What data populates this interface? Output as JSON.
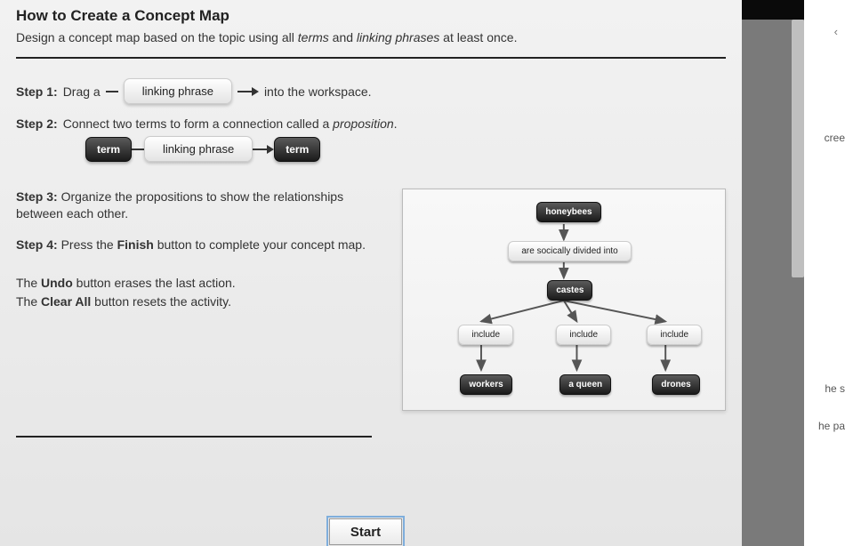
{
  "title": "How to Create a Concept Map",
  "intro_pre": "Design a concept map based on the topic using all ",
  "intro_terms": "terms",
  "intro_and": " and ",
  "intro_linking": "linking phrases",
  "intro_post": " at least once.",
  "step1": {
    "label": "Step 1:",
    "pre": "Drag a",
    "pill": "linking phrase",
    "post": "into the workspace."
  },
  "step2": {
    "label": "Step 2:",
    "text_pre": "Connect two terms to form a connection called a ",
    "text_em": "proposition",
    "text_post": ".",
    "term1": "term",
    "link": "linking phrase",
    "term2": "term"
  },
  "step3": {
    "label": "Step 3:",
    "text": "Organize the propositions to show the relationships between each other."
  },
  "step4": {
    "label": "Step 4:",
    "pre": "Press the ",
    "bold": "Finish",
    "post": " button to complete your concept map."
  },
  "undo": {
    "pre": "The ",
    "bold": "Undo",
    "post": " button erases the last action."
  },
  "clear": {
    "pre": "The ",
    "bold": "Clear All",
    "post": " button resets the activity."
  },
  "diagram": {
    "honeybees": "honeybees",
    "divided": "are socically divided into",
    "castes": "castes",
    "include1": "include",
    "include2": "include",
    "include3": "include",
    "workers": "workers",
    "queen": "a queen",
    "drones": "drones"
  },
  "start_label": "Start",
  "fragments": {
    "f1": "cree",
    "f2": "he s",
    "f3": "he pa"
  }
}
